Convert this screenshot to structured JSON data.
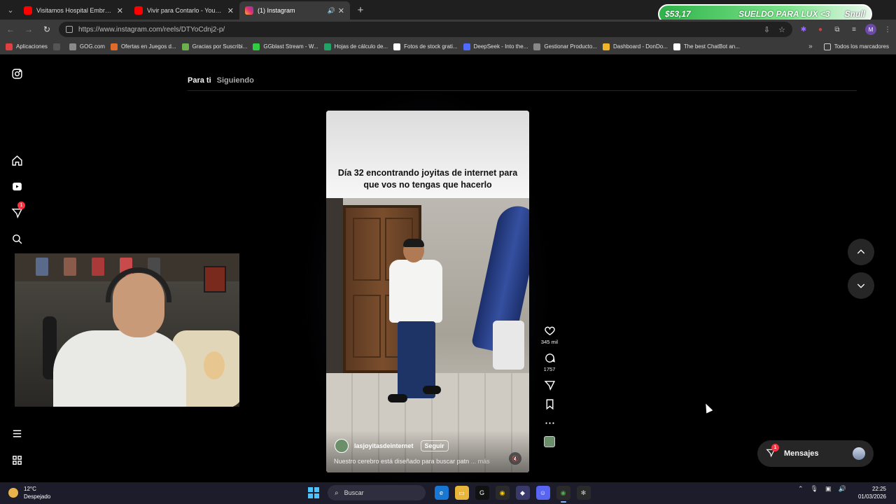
{
  "browser": {
    "tabs": [
      {
        "title": "Visitamos Hospital Embrujado c",
        "favicon": "youtube-icon",
        "active": false
      },
      {
        "title": "Vivir para Contarlo - YouTube",
        "favicon": "youtube-icon",
        "active": false
      },
      {
        "title": "(1) Instagram",
        "favicon": "instagram-icon",
        "active": true
      }
    ],
    "url": "https://www.instagram.com/reels/DTYoCdnj2-p/",
    "bookmarks": [
      {
        "label": "Aplicaciones",
        "color": "#e04040"
      },
      {
        "label": "GOG.com",
        "color": "#8a8a8a"
      },
      {
        "label": "Ofertas en Juegos d...",
        "color": "#e06a2a"
      },
      {
        "label": "Gracias por Suscribi...",
        "color": "#6ab04c"
      },
      {
        "label": "GGblast Stream - W...",
        "color": "#2ecc40"
      },
      {
        "label": "Hojas de cálculo de...",
        "color": "#21a366"
      },
      {
        "label": "Fotos de stock grati...",
        "color": "#ffffff"
      },
      {
        "label": "DeepSeek - Into the...",
        "color": "#4d6bfe"
      },
      {
        "label": "Gestionar Producto...",
        "color": "#888888"
      },
      {
        "label": "Dashboard - DonDo...",
        "color": "#f0b429"
      },
      {
        "label": "The best ChatBot an...",
        "color": "#ffffff"
      }
    ],
    "bookmarks_all": "Todos los marcadores"
  },
  "overlay": {
    "amount": "$53,17",
    "message": "SUELDO PARA LUX <3",
    "user": "Snull"
  },
  "feed": {
    "tab_for_you": "Para ti",
    "tab_following": "Siguiendo"
  },
  "reel": {
    "caption": "Día 32 encontrando joyitas de internet para que vos no tengas que hacerlo",
    "username": "lasjoyitasdeinternet",
    "follow_label": "Seguir",
    "description": "Nuestro cerebro está diseñado para buscar patn",
    "more_label": "... más",
    "likes": "345 mil",
    "comments": "1757"
  },
  "sidebar": {
    "notifications_count": "1"
  },
  "messages": {
    "label": "Mensajes",
    "badge": "1"
  },
  "taskbar": {
    "temperature": "12°C",
    "condition": "Despejado",
    "search_placeholder": "Buscar",
    "time": "22:25",
    "date": "01/03/2026"
  }
}
